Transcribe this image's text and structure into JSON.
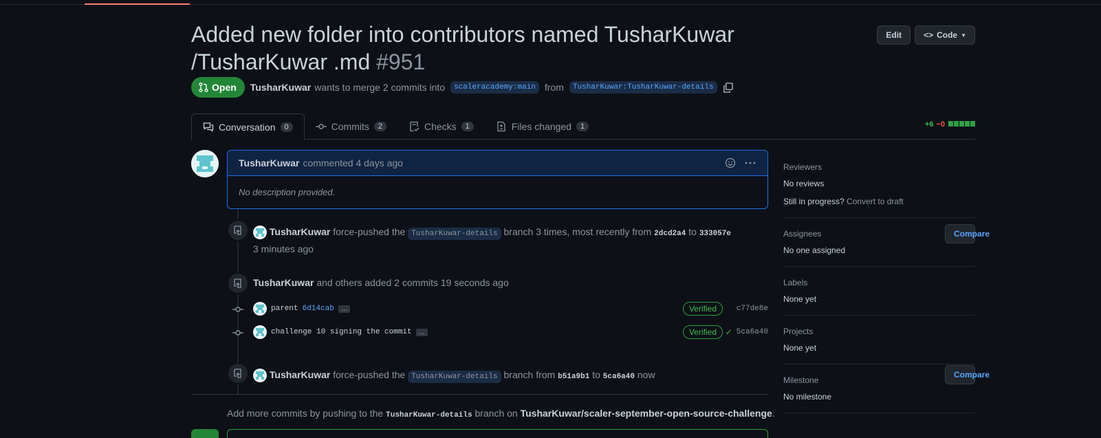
{
  "pr": {
    "title": "Added new folder into contributors named TusharKuwar /TusharKuwar .md",
    "number": "#951",
    "edit_label": "Edit",
    "code_label": "Code",
    "state": "Open",
    "author": "TusharKuwar",
    "merge_text": "wants to merge 2 commits into",
    "base_branch": "scaleracademy:main",
    "from_text": "from",
    "head_branch": "TusharKuwar:TusharKuwar-details"
  },
  "tabs": [
    {
      "label": "Conversation",
      "count": "0"
    },
    {
      "label": "Commits",
      "count": "2"
    },
    {
      "label": "Checks",
      "count": "1"
    },
    {
      "label": "Files changed",
      "count": "1"
    }
  ],
  "diffstat": {
    "additions": "+6",
    "deletions": "−0"
  },
  "comment": {
    "author": "TusharKuwar",
    "meta": "commented 4 days ago",
    "body": "No description provided."
  },
  "events": {
    "force1": {
      "author": "TusharKuwar",
      "text1": "force-pushed the",
      "branch": "TusharKuwar-details",
      "text2": "branch 3 times, most recently from",
      "from_sha": "2dcd2a4",
      "to_text": "to",
      "to_sha": "333057e",
      "time": "3 minutes ago",
      "compare": "Compare"
    },
    "commits_added": {
      "author": "TusharKuwar",
      "text": "and others added 2 commits 19 seconds ago"
    },
    "commit1": {
      "msg": "parent",
      "parent_sha": "6d14cab",
      "verified": "Verified",
      "sha": "c77de8e"
    },
    "commit2": {
      "msg": "challenge 10 signing the commit",
      "verified": "Verified",
      "sha": "5ca6a40"
    },
    "force2": {
      "author": "TusharKuwar",
      "text1": "force-pushed the",
      "branch": "TusharKuwar-details",
      "text2": "branch from",
      "from_sha": "b51a9b1",
      "to_text": "to",
      "to_sha": "5ca6a40",
      "time": "now",
      "compare": "Compare"
    }
  },
  "push_note": {
    "prefix": "Add more commits by pushing to the",
    "branch": "TusharKuwar-details",
    "middle": "branch on",
    "repo": "TusharKuwar/scaler-september-open-source-challenge",
    "suffix": "."
  },
  "sidebar": {
    "reviewers_title": "Reviewers",
    "reviewers_value": "No reviews",
    "in_progress": "Still in progress?",
    "convert": "Convert to draft",
    "assignees_title": "Assignees",
    "assignees_value": "No one assigned",
    "labels_title": "Labels",
    "labels_value": "None yet",
    "projects_title": "Projects",
    "projects_value": "None yet",
    "milestone_title": "Milestone",
    "milestone_value": "No milestone"
  }
}
